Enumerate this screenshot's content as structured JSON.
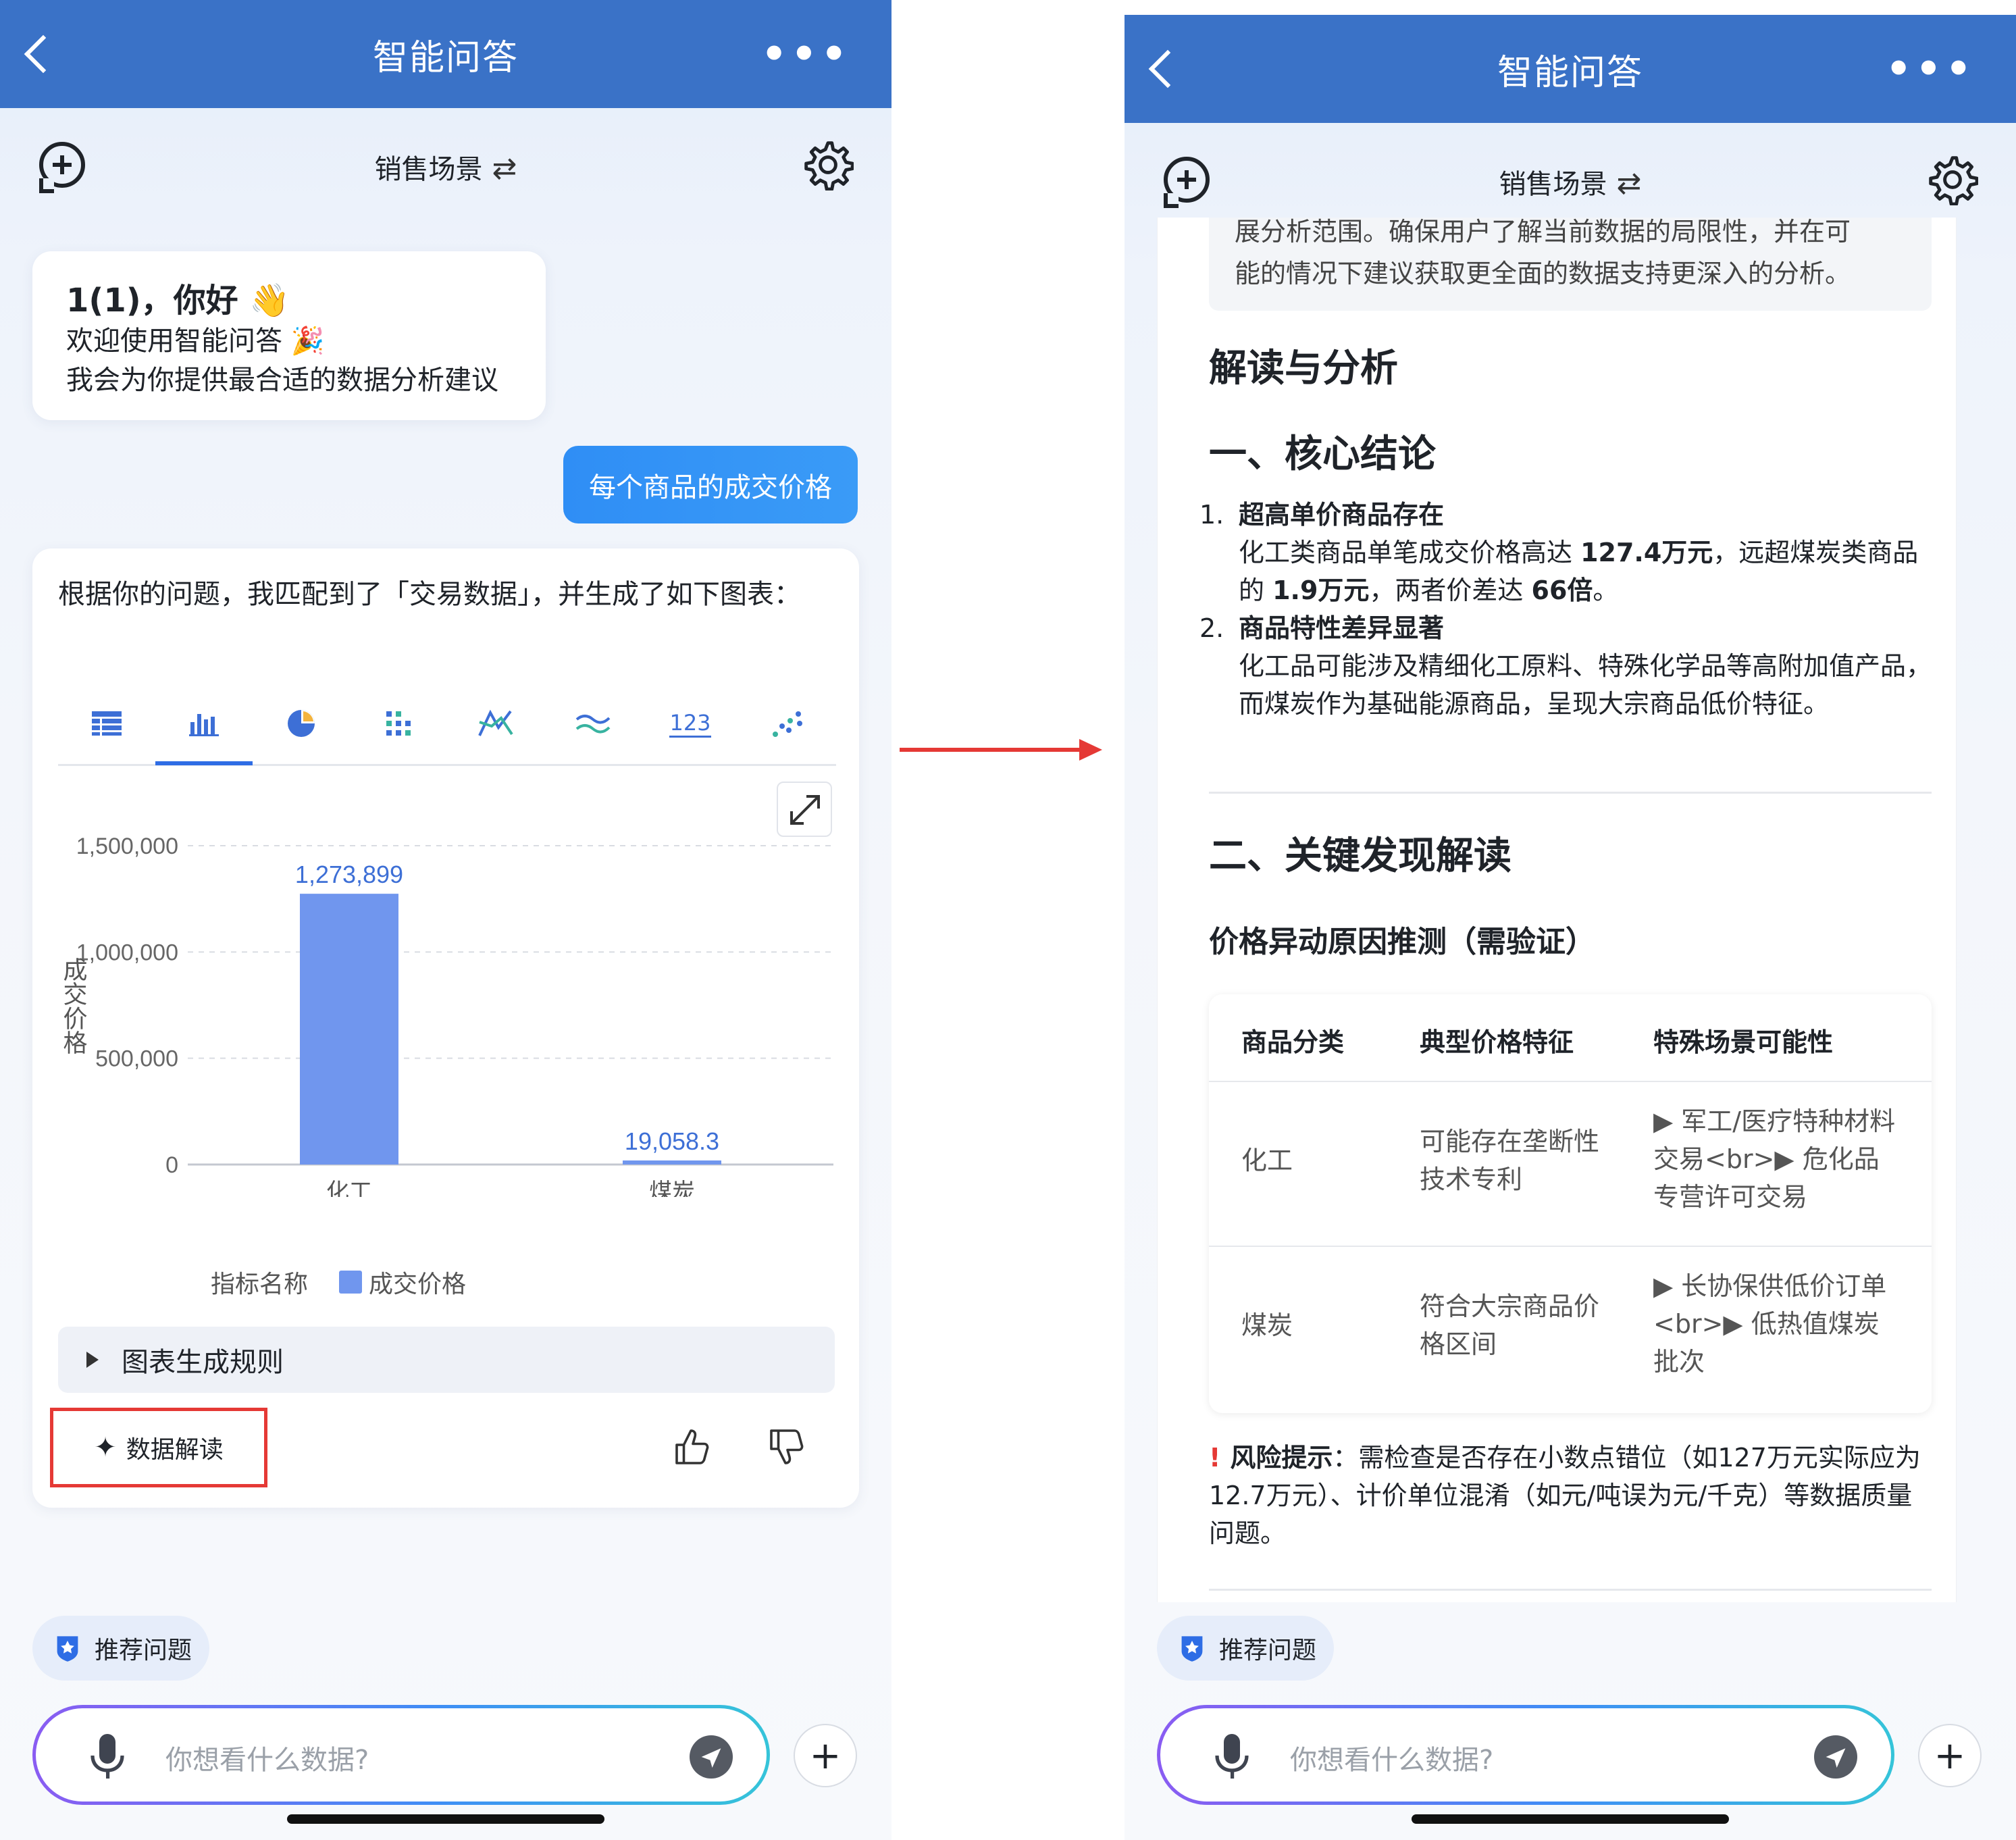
{
  "nav": {
    "title": "智能问答",
    "more": "•••"
  },
  "scene": {
    "label": "销售场景",
    "swap_icon": "⇄"
  },
  "greeting": {
    "title": "1(1)，你好 👋",
    "line1": "欢迎使用智能问答 🎉",
    "line2": "我会为你提供最合适的数据分析建议"
  },
  "user_message": "每个商品的成交价格",
  "answer": {
    "intro": "根据你的问题，我匹配到了「交易数据」，并生成了如下图表：",
    "chart_tabs": [
      "table",
      "bar",
      "pie",
      "grid",
      "line-multi",
      "area",
      "number",
      "scatter"
    ],
    "active_tab": "bar",
    "chart_number_tab_label": "123",
    "rules_label": "图表生成规则",
    "interpret_label": "数据解读",
    "legend_title": "指标名称",
    "legend_series": "成交价格"
  },
  "chart_data": {
    "type": "bar",
    "categories": [
      "化工",
      "煤炭"
    ],
    "series": [
      {
        "name": "成交价格",
        "values": [
          1273899,
          19058.3
        ]
      }
    ],
    "value_labels": [
      "1,273,899",
      "19,058.3"
    ],
    "ylabel": "成交价格",
    "yticks": [
      "0",
      "500,000",
      "1,000,000",
      "1,500,000"
    ],
    "ylim": [
      0,
      1500000
    ],
    "grid": true,
    "legend": "bottom",
    "color": "#7096ee"
  },
  "bottom": {
    "recommend_label": "推荐问题",
    "input_placeholder": "你想看什么数据?",
    "plus": "+"
  },
  "doc": {
    "quote_line1": "展分析范围。确保用户了解当前数据的局限性，并在可",
    "quote_line2": "能的情况下建议获取更全面的数据支持更深入的分析。",
    "heading_main": "解读与分析",
    "heading_1": "一、核心结论",
    "item1_num": "1.",
    "item1_title": "超高单价商品存在",
    "item1_text_a": "化工类商品单笔成交价格高达 ",
    "item1_bold_a": "127.4万元",
    "item1_text_b": "，远超煤炭类商品的 ",
    "item1_bold_b": "1.9万元",
    "item1_text_c": "，两者价差达 ",
    "item1_bold_c": "66倍",
    "item1_text_d": "。",
    "item2_num": "2.",
    "item2_title": "商品特性差异显著",
    "item2_text": "化工品可能涉及精细化工原料、特殊化学品等高附加值产品，而煤炭作为基础能源商品，呈现大宗商品低价特征。",
    "heading_2": "二、关键发现解读",
    "subheading": "价格异动原因推测（需验证）",
    "table": {
      "headers": [
        "商品分类",
        "典型价格特征",
        "特殊场景可能性"
      ],
      "rows": [
        [
          "化工",
          "可能存在垄断性技术专利",
          "▶ 军工/医疗特种材料交易<br>▶ 危化品专营许可交易"
        ],
        [
          "煤炭",
          "符合大宗商品价格区间",
          "▶ 长协保供低价订单<br>▶ 低热值煤炭批次"
        ]
      ]
    },
    "risk_label": "风险提示",
    "risk_text": "：需检查是否存在小数点错位（如127万元实际应为12.7万元）、计价单位混淆（如元/吨误为元/千克）等数据质量问题。"
  }
}
